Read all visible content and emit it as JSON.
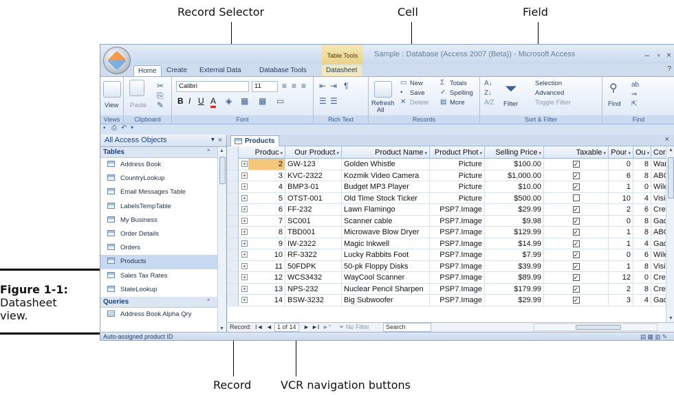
{
  "callouts": {
    "record_selector": "Record Selector",
    "cell": "Cell",
    "field": "Field",
    "record": "Record",
    "vcr": "VCR navigation buttons"
  },
  "figure": {
    "label": "Figure 1-1:",
    "caption_line1": "Datasheet",
    "caption_line2": "view."
  },
  "window": {
    "title": "Sample : Database (Access 2007 (Beta)) - Microsoft Access",
    "contextual_tab": "Table Tools",
    "minimize": "–",
    "restore": "▫",
    "close": "×",
    "help": "?"
  },
  "tabs": [
    "Home",
    "Create",
    "External Data",
    "Database Tools",
    "Datasheet"
  ],
  "ribbon": {
    "views": {
      "label": "Views",
      "view": "View"
    },
    "clipboard": {
      "label": "Clipboard",
      "paste": "Paste"
    },
    "font": {
      "label": "Font",
      "name": "Calibri",
      "size": "11"
    },
    "rich_text": {
      "label": "Rich Text"
    },
    "records": {
      "label": "Records",
      "refresh": "Refresh",
      "refresh_sub": "All",
      "new": "New",
      "save": "Save",
      "delete": "Delete",
      "totals": "Totals",
      "spelling": "Spelling",
      "more": "More"
    },
    "sort_filter": {
      "label": "Sort & Filter",
      "filter": "Filter",
      "selection": "Selection",
      "advanced": "Advanced",
      "toggle": "Toggle Filter"
    },
    "find": {
      "label": "Find",
      "find": "Find"
    }
  },
  "nav": {
    "header": "All Access Objects",
    "groups": {
      "tables": "Tables",
      "queries": "Queries"
    },
    "tables": [
      "Address Book",
      "CountryLookup",
      "Email Messages Table",
      "LabelsTempTable",
      "My Business",
      "Order Details",
      "Orders",
      "Products",
      "Sales Tax Rates",
      "StateLookup"
    ],
    "queries": [
      "Address Book Alpha Qry"
    ],
    "selected": "Products"
  },
  "datasheet": {
    "tab": "Products",
    "columns": [
      "Produc",
      "Our Product",
      "Product Name",
      "Product Phot",
      "Selling Price",
      "Taxable",
      "Pour",
      "Ou",
      "Cont"
    ],
    "rows": [
      {
        "id": "2",
        "code": "GW-123",
        "name": "Golden Whistle",
        "photo": "Picture",
        "price": "$100.00",
        "taxable": true,
        "pour": "0",
        "ou": "8",
        "cont": "Wan"
      },
      {
        "id": "3",
        "code": "KVC-2322",
        "name": "Kozmik Video Camera",
        "photo": "Picture",
        "price": "$1,000.00",
        "taxable": true,
        "pour": "6",
        "ou": "8",
        "cont": "ABC"
      },
      {
        "id": "4",
        "code": "BMP3-01",
        "name": "Budget MP3 Player",
        "photo": "Picture",
        "price": "$10.00",
        "taxable": true,
        "pour": "1",
        "ou": "0",
        "cont": "Wile"
      },
      {
        "id": "5",
        "code": "OTST-001",
        "name": "Old Time Stock Ticker",
        "photo": "Picture",
        "price": "$500.00",
        "taxable": false,
        "pour": "10",
        "ou": "4",
        "cont": "Visic"
      },
      {
        "id": "6",
        "code": "FF-232",
        "name": "Lawn Flamingo",
        "photo": "PSP7.Image",
        "price": "$29.99",
        "taxable": true,
        "pour": "2",
        "ou": "6",
        "cont": "Crea"
      },
      {
        "id": "7",
        "code": "SC001",
        "name": "Scanner cable",
        "photo": "PSP7.Image",
        "price": "$9.98",
        "taxable": true,
        "pour": "0",
        "ou": "8",
        "cont": "Gadg"
      },
      {
        "id": "8",
        "code": "TBD001",
        "name": "Microwave Blow Dryer",
        "photo": "PSP7.Image",
        "price": "$129.99",
        "taxable": true,
        "pour": "1",
        "ou": "8",
        "cont": "ABC"
      },
      {
        "id": "9",
        "code": "IW-2322",
        "name": "Magic Inkwell",
        "photo": "PSP7.Image",
        "price": "$14.99",
        "taxable": true,
        "pour": "1",
        "ou": "4",
        "cont": "Gadg"
      },
      {
        "id": "10",
        "code": "RF-3322",
        "name": "Lucky Rabbits Foot",
        "photo": "PSP7.Image",
        "price": "$7.99",
        "taxable": true,
        "pour": "0",
        "ou": "6",
        "cont": "Wile"
      },
      {
        "id": "11",
        "code": "50FDPK",
        "name": "50-pk Floppy Disks",
        "photo": "PSP7.Image",
        "price": "$39.99",
        "taxable": true,
        "pour": "1",
        "ou": "8",
        "cont": "Visic"
      },
      {
        "id": "12",
        "code": "WCS3432",
        "name": "WayCool Scanner",
        "photo": "PSP7.Image",
        "price": "$89.99",
        "taxable": true,
        "pour": "12",
        "ou": "0",
        "cont": "Crea"
      },
      {
        "id": "13",
        "code": "NPS-232",
        "name": "Nuclear Pencil Sharpen",
        "photo": "PSP7.Image",
        "price": "$179.99",
        "taxable": true,
        "pour": "2",
        "ou": "8",
        "cont": "Crea"
      },
      {
        "id": "14",
        "code": "BSW-3232",
        "name": "Big Subwoofer",
        "photo": "PSP7.Image",
        "price": "$29.99",
        "taxable": true,
        "pour": "3",
        "ou": "4",
        "cont": "Gadg"
      }
    ]
  },
  "record_nav": {
    "label": "Record:",
    "first": "I◄",
    "prev": "◄",
    "position": "1 of 14",
    "next": "►",
    "last": "►I",
    "new": "►*",
    "filter": "No Filter",
    "search": "Search"
  },
  "status": {
    "text": "Auto-assigned product ID"
  },
  "colors": {
    "accent": "#15428b",
    "ribbon": "#dfe9f5",
    "selected": "#c7d9f1"
  }
}
